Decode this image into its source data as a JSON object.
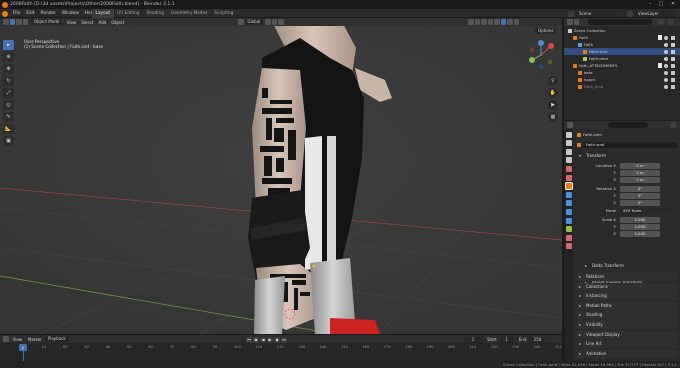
{
  "window": {
    "title": "2008Faith [D:\\3d assets\\Projects\\Other\\2008Faith.blend] - Blender 3.1.1"
  },
  "menu": {
    "items": [
      "File",
      "Edit",
      "Render",
      "Window",
      "Help"
    ],
    "tabs": [
      "Layout",
      "UV Editing",
      "Shading",
      "Geometry Nodes",
      "Scripting"
    ],
    "scene_label": "Scene",
    "viewlayer_label": "ViewLayer"
  },
  "viewport": {
    "mode": "Object Mode",
    "menus": [
      "View",
      "Select",
      "Add",
      "Object"
    ],
    "orientation": "Global",
    "options_label": "Options",
    "info_line1": "User Perspective",
    "info_line2": "(1) Scene Collection | Faith.snd : base"
  },
  "outliner": {
    "search_placeholder": "",
    "rows": [
      {
        "label": "Scene Collection",
        "indent": 0,
        "icon_color": "#c8c8c8"
      },
      {
        "label": "Faith",
        "indent": 1,
        "icon_color": "#e87d0d"
      },
      {
        "label": "Faith",
        "indent": 2,
        "icon_color": "#4aa3e0"
      },
      {
        "label": "Faith.smd",
        "indent": 3,
        "icon_color": "#e87d0d"
      },
      {
        "label": "Faith.pmd",
        "indent": 3,
        "icon_color": "#a0d050"
      },
      {
        "label": "faith_ATTACHMENTS",
        "indent": 1,
        "icon_color": "#e87d0d"
      },
      {
        "label": "beta",
        "indent": 2,
        "icon_color": "#e87d0d"
      },
      {
        "label": "hooch",
        "indent": 2,
        "icon_color": "#e87d0d"
      },
      {
        "label": "Faith_bind",
        "indent": 2,
        "icon_color": "#e87d0d",
        "muted": true
      }
    ]
  },
  "properties": {
    "object_name": "Faith.smd",
    "object_data": "Faith.smd",
    "transform_title": "Transform",
    "location_label": "Location X",
    "location": [
      "0 m",
      "0 m",
      "0 m"
    ],
    "rotation_label": "Rotation X",
    "rotation": [
      "0°",
      "0°",
      "0°"
    ],
    "mode_label": "Mode",
    "mode_value": "XYZ Euler",
    "scale_label": "Scale X",
    "scale": [
      "1.000",
      "1.000",
      "1.000"
    ],
    "axis_y": "Y",
    "axis_z": "Z",
    "subpanels": [
      "Delta Transform",
      "Parent Inverse Transform"
    ],
    "panels": [
      "Relations",
      "Collections",
      "Instancing",
      "Motion Paths",
      "Shading",
      "Visibility",
      "Viewport Display",
      "Line Art",
      "Animation"
    ]
  },
  "timeline": {
    "menus": [
      "View",
      "Marker",
      "Playback"
    ],
    "current_frame": "1",
    "start_label": "Start",
    "start": "1",
    "end_label": "End",
    "end": "250",
    "ticks": [
      "0",
      "10",
      "20",
      "30",
      "40",
      "50",
      "60",
      "70",
      "80",
      "90",
      "100",
      "110",
      "120",
      "130",
      "140",
      "150",
      "160",
      "170",
      "180",
      "190",
      "200",
      "210",
      "220",
      "230",
      "240",
      "250"
    ]
  },
  "statusbar": {
    "text": "Scene Collection | Faith.pmd | Verts 22,026 | Faces 19,994 | Tris 37,777 | Objects 0/3 | 3.1.1"
  },
  "colors": {
    "accent": "#4772b3",
    "background": "#393939",
    "panel": "#2b2b2b"
  }
}
